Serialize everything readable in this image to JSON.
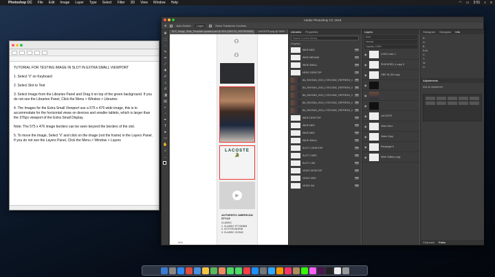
{
  "menubar": {
    "app_name": "Photoshop CC",
    "items": [
      "File",
      "Edit",
      "Image",
      "Layer",
      "Type",
      "Select",
      "Filter",
      "3D",
      "View",
      "Window",
      "Help"
    ],
    "clock": "3:51"
  },
  "textedit": {
    "body": [
      "TUTORIAL FOR TESTING IMAGE IN SLOT IN EXTRA SMALL VIEWPORT",
      "1. Select 'V' on Keyboard",
      "2. Select Slot to Test",
      "3. Select Image from the Libraries Panel and Drag it on top of the green background.  If you do not see the Libraries Panel, Click the Menu > Window > Libraries",
      "4. The Images for the Extra Small Viewport use a 575 x 476 wide image, this is to accommodate for the horizontal views on devices and smaller tablets, which is larger than the 376px viewport of the Extra Small Display.",
      "Note: The 575 x 476 image borders can be seen beyond the borders of the slot.",
      "5. To move the image, Select 'V' and click on the image (not the frame) in the Layers Panel.  If you do not see the Layers Panel, Click the Menu > Window > Layers"
    ]
  },
  "photoshop": {
    "title": "Adobe Photoshop CC 2018",
    "options": [
      "Auto-Select:",
      "Layer",
      "Show Transform Controls"
    ],
    "tabs": [
      "SLP_Image_Slots_Template-updated.psd @ 50% (OBG IN_HOE/RGB/8#)",
      "LACOSTE.png @ 100%"
    ],
    "zoom": "50%",
    "doc": {
      "brand": "LACOSTE",
      "crocodile": "🐊",
      "heading": "AUTHENTIC AMERICAN STYLE",
      "lines": [
        "CLASSIC",
        "1. CLASSIC FIT DENIM",
        "2. COTTON BLEND",
        "3. CLASSIC ICONIC"
      ]
    },
    "libraries": {
      "tabs": [
        "Libraries",
        "Properties"
      ],
      "search": "Search Current Library",
      "group": "Graphics",
      "items": [
        {
          "name": "WIDE MED",
          "badge": "PSD",
          "thumb": "white"
        },
        {
          "name": "WIDE MEDIUM",
          "badge": "PSD",
          "thumb": "white"
        },
        {
          "name": "WIDE SMALL",
          "badge": "PSD",
          "thumb": "white"
        },
        {
          "name": "HERO DESKTOP",
          "badge": "PSD",
          "thumb": "white"
        },
        {
          "name": "BA_RAYSAN_2019_CYECOMC_REFRESH_VIDEO...",
          "badge": "JPG",
          "thumb": "photo"
        },
        {
          "name": "BA_RAYSAN_2019_CYECOMC_REFRESH_VIDEO...",
          "badge": "JPG",
          "thumb": "photo"
        },
        {
          "name": "BA_RAYSAN_2019_CYECOMC_REFRESH_VIDEO...",
          "badge": "JPG",
          "thumb": "photo"
        },
        {
          "name": "BA_RAYSAN_2019_CYECOMC_REFRESH_VIDEO...",
          "badge": "JPG",
          "thumb": "photo"
        },
        {
          "name": "BA_RAYSAN_2019_CYECOMC_REFRESH_VIDEO...",
          "badge": "JPG",
          "thumb": "photo"
        },
        {
          "name": "WIDE DESKTOP",
          "badge": "PSD",
          "thumb": "white"
        },
        {
          "name": "WIDE MED",
          "badge": "PSD",
          "thumb": "white"
        },
        {
          "name": "WIDE MED",
          "badge": "PSD",
          "thumb": "white"
        },
        {
          "name": "WIDE SMALL",
          "badge": "PSD",
          "thumb": "white"
        },
        {
          "name": "SLOT 1 DESKTOP",
          "badge": "PSD",
          "thumb": "white"
        },
        {
          "name": "SLOT 1 MED",
          "badge": "PSD",
          "thumb": "white"
        },
        {
          "name": "SLOT 1 SM",
          "badge": "PSD",
          "thumb": "white"
        },
        {
          "name": "VIDEO DESKTOP",
          "badge": "PSD",
          "thumb": "white"
        },
        {
          "name": "VIDEO MED",
          "badge": "PSD",
          "thumb": "white"
        },
        {
          "name": "VIDEO SM",
          "badge": "PSD",
          "thumb": "white"
        }
      ]
    },
    "layers": {
      "title": "Layers",
      "kind": "Kind",
      "mode": "Normal",
      "opacity": "Opacity: 100%",
      "rows": [
        {
          "name": "LOGO color 1",
          "thumb": "white"
        },
        {
          "name": "FEATURED_4 copy 5",
          "thumb": "white"
        },
        {
          "name": "OBG IN_BG copy",
          "thumb": "white"
        },
        {
          "name": "",
          "thumb": "dark"
        },
        {
          "name": "",
          "thumb": "photo"
        },
        {
          "name": "",
          "thumb": "dark"
        },
        {
          "name": "LACOSTE",
          "thumb": "white"
        },
        {
          "name": "Video Hero",
          "thumb": "white"
        },
        {
          "name": "Video Copy",
          "thumb": "white"
        },
        {
          "name": "Rectangle 6",
          "thumb": "white"
        },
        {
          "name": "Wide Gallery copy",
          "thumb": "white"
        }
      ]
    },
    "props": {
      "tabs": [
        "Histogram",
        "Navigator",
        "Info"
      ],
      "info": [
        "R:",
        "G:",
        "B:",
        "8-bit",
        "X:",
        "Y:",
        "W:",
        "H:"
      ],
      "adjustments": "Adjustments",
      "add_adjust": "Add an adjustment",
      "bottom_tabs": [
        "Channels",
        "Paths"
      ]
    }
  },
  "dock": {
    "apps": [
      "Finder",
      "Launchpad",
      "Safari",
      "Chrome",
      "Mail",
      "Notes",
      "Maps",
      "Photos",
      "Messages",
      "FaceTime",
      "Music",
      "App Store",
      "Preferences",
      "Photoshop",
      "Illustrator",
      "InDesign",
      "Bridge",
      "Dreamweaver",
      "XD",
      "Slack",
      "Terminal",
      "TextEdit",
      "Trash"
    ]
  }
}
